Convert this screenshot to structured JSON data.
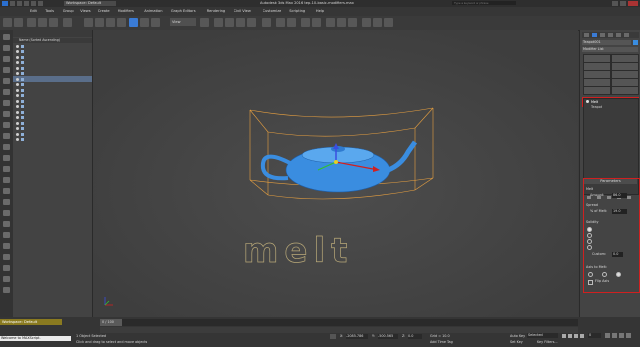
{
  "titlebar": {
    "workspace": "Workspace: Default",
    "title": "Autodesk 3ds Max 2016   tep-10-basic-modifiers.max",
    "search_placeholder": "Type a keyword or phrase"
  },
  "menus": [
    "Edit",
    "Tools",
    "Group",
    "Views",
    "Create",
    "Modifiers",
    "Animation",
    "Graph Editors",
    "Rendering",
    "Civil View",
    "Customize",
    "Scripting",
    "Help"
  ],
  "toolbar": {
    "view_select": "View"
  },
  "explorer": {
    "tabs": [
      "Select",
      "Display",
      "Edit",
      "Customize"
    ],
    "header": "Name (Sorted Ascending)",
    "items": [
      "(default)",
      "Box001",
      "Box002",
      "Box003",
      "Box004",
      "Camera001",
      "Teapot001",
      "Teapot002",
      "Text001",
      "Text002",
      "Text003",
      "Text004",
      "Text005",
      "Text006",
      "Text007",
      "Text008",
      "Text009",
      "Text010"
    ]
  },
  "viewport": {
    "label": "[+] [Perspective ] [Realistic]",
    "text_object": "melt",
    "timeline_label": "0 / 100"
  },
  "command_panel": {
    "object_name": "Teapot001",
    "modifier_list": "Modifier List",
    "mod_buttons": [
      "Edit Mesh",
      "Edit Spline",
      "Extrude",
      "Lathe",
      "Unw Map",
      "TurboSmooth",
      "Shell",
      "Symmetry",
      "Mesh Select",
      "Poly Select"
    ],
    "stack": [
      {
        "label": "Melt"
      },
      {
        "label": "Teapot"
      }
    ],
    "rollout_title": "Parameters",
    "melt_label": "Melt",
    "amount_label": "Amount:",
    "amount_value": "86.0",
    "spread_label": "Spread",
    "spread_pct_label": "% of Melt:",
    "spread_value": "19.0",
    "solidity_label": "Solidity",
    "solidity_options": [
      {
        "label": "Ice (Default)",
        "value": "2.0",
        "checked": true
      },
      {
        "label": "Glass",
        "value": "12.0",
        "checked": false
      },
      {
        "label": "Jelly",
        "value": "0.4",
        "checked": false
      },
      {
        "label": "Plastic",
        "value": "0.6",
        "checked": false
      }
    ],
    "custom_label": "Custom:",
    "custom_value": "0.0",
    "axis_label": "Axis to Melt:",
    "axes": [
      "X",
      "Y",
      "Z"
    ],
    "flip_label": "Flip Axis"
  },
  "status": {
    "workspace_footer": "Workspace: Default",
    "console": "Welcome to MAXScript.",
    "selection": "1 Object Selected",
    "hint": "Click and drag to select and move objects",
    "grid": "Grid = 10.0",
    "add_time_tag": "Add Time Tag",
    "autokey": "Auto Key",
    "selected": "Selected",
    "set_key": "Set Key",
    "key_filters": "Key Filters...",
    "frame": "0",
    "x_value": "-2085.786",
    "y_value": "-500.565",
    "z_value": "0.0",
    "ticks": [
      "0",
      "10",
      "20",
      "30",
      "40",
      "50",
      "60",
      "70",
      "80",
      "90",
      "100"
    ]
  },
  "colors": {
    "accent": "#3a7bd5",
    "highlight": "#d02020",
    "teapot": "#3a8de0",
    "selection_box": "#e8a040"
  }
}
